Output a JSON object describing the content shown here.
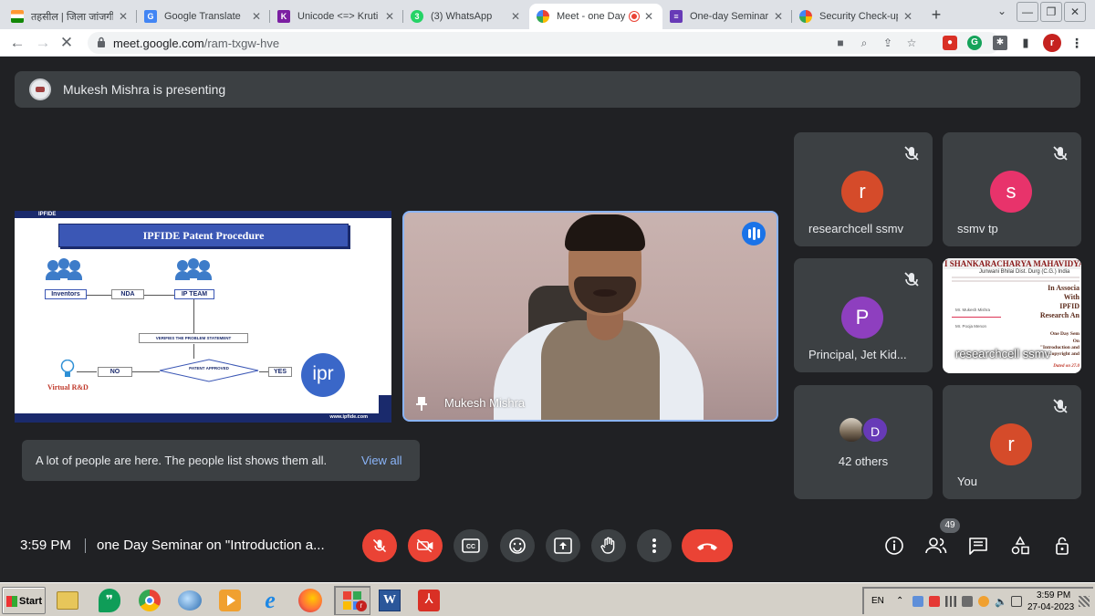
{
  "browser": {
    "tabs": [
      {
        "title": "तहसील | जिला जांजगी",
        "favicon": "india-flag-icon",
        "color": "#ff9933"
      },
      {
        "title": "Google Translate",
        "favicon": "google-translate-icon",
        "color": "#4285f4"
      },
      {
        "title": "Unicode <=> Kruti D",
        "favicon": "kruti-icon",
        "color": "#7b1fa2"
      },
      {
        "title": "(3) WhatsApp",
        "favicon": "whatsapp-icon",
        "color": "#25d366",
        "badge": "3"
      },
      {
        "title": "Meet - one Day",
        "favicon": "google-icon",
        "color": "#ea4335",
        "active": true,
        "recording": true
      },
      {
        "title": "One-day Seminar on",
        "favicon": "forms-icon",
        "color": "#673ab7"
      },
      {
        "title": "Security Check-up",
        "favicon": "google-icon",
        "color": "#4285f4"
      }
    ],
    "address": {
      "host": "meet.google.com",
      "path": "/ram-txgw-hve"
    },
    "profile_initial": "r"
  },
  "meet": {
    "presenting_text": "Mukesh Mishra is presenting",
    "slide": {
      "brand_top": "IPFIDE",
      "title": "IPFIDE Patent Procedure",
      "inventors": "Inventors",
      "nda": "NDA",
      "ip_team": "IP TEAM",
      "verifies": "VERIFIES THE PROBLEM STATEMENT",
      "no": "NO",
      "patent_approval": "PATENT APPROVED",
      "yes": "YES",
      "virtual": "Virtual R&D",
      "ipr": "ipr",
      "website": "www.ipfide.com"
    },
    "speaker_name": "Mukesh Mishra",
    "participants": [
      {
        "initial": "r",
        "name": "researchcell ssmv",
        "color": "#d54b2a"
      },
      {
        "initial": "s",
        "name": "ssmv tp",
        "color": "#e8336b"
      },
      {
        "initial": "P",
        "name": "Principal, Jet Kid...",
        "color": "#8e3fbf"
      },
      {
        "initial": "D",
        "name": "42 others",
        "color": "#673ab7"
      },
      {
        "initial": "r",
        "name": "You",
        "color": "#d54b2a"
      }
    ],
    "poster": {
      "header": "I SHANKARACHARYA MAHAVIDYAL",
      "sub": "Junwani Bhilai Dist. Durg (C.G.) India",
      "in_assoc": "In Associa",
      "with": "With",
      "ipfide": "IPFID",
      "research": "Research An",
      "speaker1": "Mr. Mukesh Mishra",
      "speaker2": "Mr. Pooja Menon",
      "one_day": "One Day Sem",
      "on": "On",
      "intro": "\"Introduction and",
      "copyright": "Copyright and",
      "dated": "Dated on 27.0",
      "name": "researchcell ssmv"
    },
    "notice": {
      "text": "A lot of people are here. The people list shows them all.",
      "link": "View all"
    },
    "time": "3:59 PM",
    "meeting_title": "one Day Seminar on \"Introduction a...",
    "people_count": "49"
  },
  "taskbar": {
    "start": "Start",
    "lang": "EN",
    "time": "3:59 PM",
    "date": "27-04-2023"
  },
  "colors": {
    "meet_bg": "#202124",
    "tile_bg": "#3c4043",
    "red": "#ea4335",
    "blue": "#8ab4f8"
  }
}
